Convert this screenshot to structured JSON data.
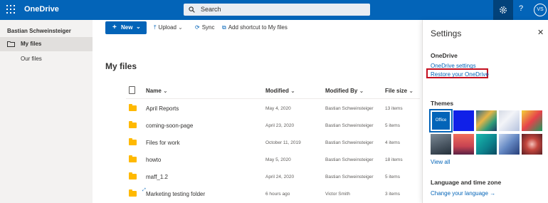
{
  "app": {
    "name": "OneDrive"
  },
  "search": {
    "placeholder": "Search"
  },
  "topbar": {
    "help_label": "?",
    "avatar_initials": "VS"
  },
  "sidebar": {
    "user": "Bastian Schweinsteiger",
    "items": [
      {
        "label": "My files",
        "selected": true
      },
      {
        "label": "Our files",
        "selected": false
      }
    ]
  },
  "commandbar": {
    "new_label": "New",
    "upload_label": "Upload",
    "sync_label": "Sync",
    "shortcut_label": "Add shortcut to My files"
  },
  "main": {
    "title": "My files"
  },
  "table": {
    "columns": {
      "name": "Name",
      "modified": "Modified",
      "modified_by": "Modified By",
      "file_size": "File size"
    },
    "rows": [
      {
        "name": "April Reports",
        "modified": "May 4, 2020",
        "modified_by": "Bastian Schweinsteiger",
        "size": "13 items"
      },
      {
        "name": "coming-soon-page",
        "modified": "April 23, 2020",
        "modified_by": "Bastian Schweinsteiger",
        "size": "5 items"
      },
      {
        "name": "Files for work",
        "modified": "October 11, 2019",
        "modified_by": "Bastian Schweinsteiger",
        "size": "4 items"
      },
      {
        "name": "howto",
        "modified": "May 5, 2020",
        "modified_by": "Bastian Schweinsteiger",
        "size": "18 items"
      },
      {
        "name": "maff_1.2",
        "modified": "April 24, 2020",
        "modified_by": "Bastian Schweinsteiger",
        "size": "5 items"
      },
      {
        "name": "Marketing testing folder",
        "modified": "6 hours ago",
        "modified_by": "Victor Smith",
        "size": "3 items"
      }
    ]
  },
  "settings": {
    "title": "Settings",
    "onedrive_heading": "OneDrive",
    "onedrive_settings_link": "OneDrive settings",
    "restore_link": "Restore your OneDrive",
    "themes_heading": "Themes",
    "office_theme_label": "Office",
    "view_all_link": "View all",
    "language_heading": "Language and time zone",
    "change_language_link": "Change your language"
  },
  "colors": {
    "brand": "#0364b8",
    "highlight_border": "#c50f1f"
  }
}
